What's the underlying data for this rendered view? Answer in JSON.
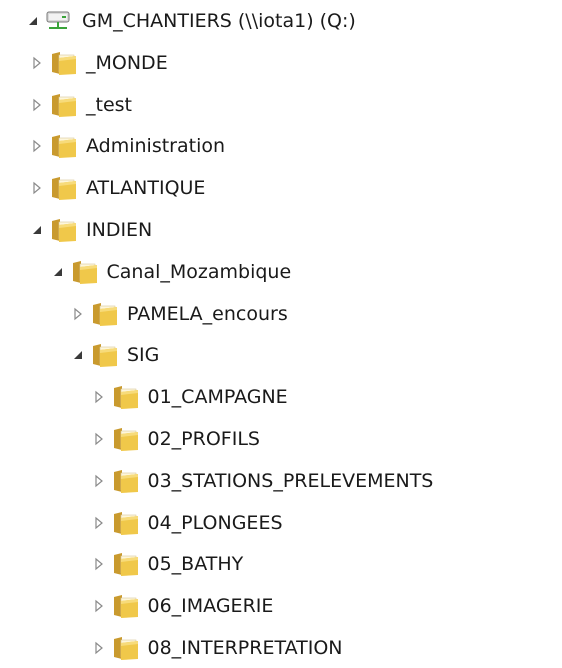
{
  "drive": {
    "label": "GM_CHANTIERS (\\\\iota1) (Q:)",
    "icon": "network-drive-icon",
    "expanded": true
  },
  "items": [
    {
      "label": "_MONDE",
      "depth": 0,
      "expanded": false
    },
    {
      "label": "_test",
      "depth": 0,
      "expanded": false
    },
    {
      "label": "Administration",
      "depth": 0,
      "expanded": false
    },
    {
      "label": "ATLANTIQUE",
      "depth": 0,
      "expanded": false
    },
    {
      "label": "INDIEN",
      "depth": 0,
      "expanded": true
    },
    {
      "label": "Canal_Mozambique",
      "depth": 1,
      "expanded": true
    },
    {
      "label": "PAMELA_encours",
      "depth": 2,
      "expanded": false
    },
    {
      "label": "SIG",
      "depth": 2,
      "expanded": true
    },
    {
      "label": "01_CAMPAGNE",
      "depth": 3,
      "expanded": false
    },
    {
      "label": "02_PROFILS",
      "depth": 3,
      "expanded": false
    },
    {
      "label": "03_STATIONS_PRELEVEMENTS",
      "depth": 3,
      "expanded": false
    },
    {
      "label": "04_PLONGEES",
      "depth": 3,
      "expanded": false
    },
    {
      "label": "05_BATHY",
      "depth": 3,
      "expanded": false
    },
    {
      "label": "06_IMAGERIE",
      "depth": 3,
      "expanded": false
    },
    {
      "label": "08_INTERPRETATION",
      "depth": 3,
      "expanded": false
    }
  ],
  "colors": {
    "folder_front": "#f0c84a",
    "folder_back": "#c99a2e",
    "folder_paper": "#fdf6dc",
    "arrow_collapsed": "#8a8a8a",
    "arrow_expanded": "#3a3a3a"
  }
}
